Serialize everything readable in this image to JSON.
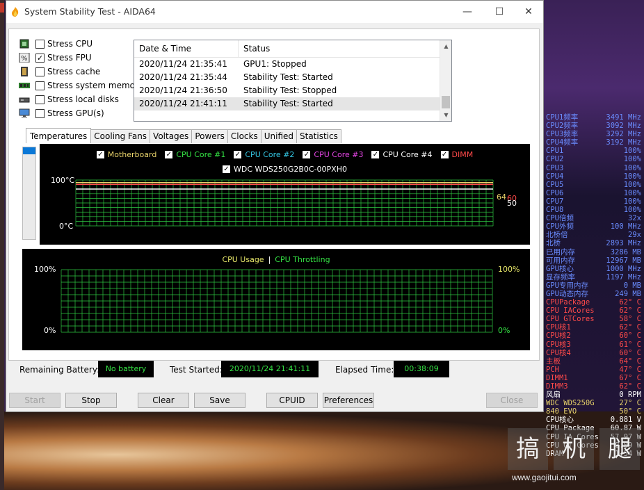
{
  "window": {
    "title": "System Stability Test - AIDA64"
  },
  "titlebar": {
    "min": "—",
    "max": "☐",
    "close": "✕"
  },
  "stress": [
    {
      "label": "Stress CPU",
      "checked": false,
      "icon": "cpu-chip-icon"
    },
    {
      "label": "Stress FPU",
      "checked": true,
      "icon": "percent-icon"
    },
    {
      "label": "Stress cache",
      "checked": false,
      "icon": "cache-chip-icon"
    },
    {
      "label": "Stress system memory",
      "checked": false,
      "icon": "memory-module-icon"
    },
    {
      "label": "Stress local disks",
      "checked": false,
      "icon": "disk-drive-icon"
    },
    {
      "label": "Stress GPU(s)",
      "checked": false,
      "icon": "monitor-icon"
    }
  ],
  "log": {
    "headers": [
      "Date & Time",
      "Status"
    ],
    "rows": [
      [
        "2020/11/24 21:35:41",
        "GPU1: Stopped"
      ],
      [
        "2020/11/24 21:35:44",
        "Stability Test: Started"
      ],
      [
        "2020/11/24 21:36:50",
        "Stability Test: Stopped"
      ],
      [
        "2020/11/24 21:41:11",
        "Stability Test: Started"
      ]
    ],
    "selected_row": 3
  },
  "tabs": [
    "Temperatures",
    "Cooling Fans",
    "Voltages",
    "Powers",
    "Clocks",
    "Unified",
    "Statistics"
  ],
  "active_tab": 0,
  "temp_chart": {
    "legend_row1": [
      {
        "label": "Motherboard",
        "color": "#e8d26a"
      },
      {
        "label": "CPU Core #1",
        "color": "#35e545"
      },
      {
        "label": "CPU Core #2",
        "color": "#35c8e5"
      },
      {
        "label": "CPU Core #3",
        "color": "#e545e5"
      },
      {
        "label": "CPU Core #4",
        "color": "#ffffff"
      },
      {
        "label": "DIMM",
        "color": "#ff4a4a"
      }
    ],
    "legend_row2": [
      {
        "label": "WDC WDS250G2B0C-00PXH0",
        "color": "#ffffff"
      }
    ],
    "y_max_label": "100°C",
    "y_min_label": "0°C",
    "value_labels": [
      "64",
      "60",
      "50"
    ],
    "value_label_colors": [
      "#e8d26a",
      "#ff4a4a",
      "#ffffff"
    ],
    "grid_color": "#2ec842"
  },
  "usage_chart": {
    "legend_a": "CPU Usage",
    "legend_sep": "|",
    "legend_b": "CPU Throttling",
    "legend_a_color": "#e8e86a",
    "legend_b_color": "#35e545",
    "y_max_left": "100%",
    "y_min_left": "0%",
    "y_max_right": "100%",
    "y_min_right": "0%"
  },
  "status": {
    "battery_label": "Remaining Battery:",
    "battery_value": "No battery",
    "started_label": "Test Started:",
    "started_value": "2020/11/24 21:41:11",
    "elapsed_label": "Elapsed Time:",
    "elapsed_value": "00:38:09"
  },
  "buttons": {
    "start": "Start",
    "stop": "Stop",
    "clear": "Clear",
    "save": "Save",
    "cpuid": "CPUID",
    "preferences": "Preferences",
    "close": "Close"
  },
  "osd": [
    {
      "k": "CPU1频率",
      "v": "3491 MHz",
      "c": "#6a8cff"
    },
    {
      "k": "CPU2频率",
      "v": "3092 MHz",
      "c": "#6a8cff"
    },
    {
      "k": "CPU3频率",
      "v": "3292 MHz",
      "c": "#6a8cff"
    },
    {
      "k": "CPU4频率",
      "v": "3192 MHz",
      "c": "#6a8cff"
    },
    {
      "k": "CPU1",
      "v": "100%",
      "c": "#6a8cff"
    },
    {
      "k": "CPU2",
      "v": "100%",
      "c": "#6a8cff"
    },
    {
      "k": "CPU3",
      "v": "100%",
      "c": "#6a8cff"
    },
    {
      "k": "CPU4",
      "v": "100%",
      "c": "#6a8cff"
    },
    {
      "k": "CPU5",
      "v": "100%",
      "c": "#6a8cff"
    },
    {
      "k": "CPU6",
      "v": "100%",
      "c": "#6a8cff"
    },
    {
      "k": "CPU7",
      "v": "100%",
      "c": "#6a8cff"
    },
    {
      "k": "CPU8",
      "v": "100%",
      "c": "#6a8cff"
    },
    {
      "k": "CPU倍频",
      "v": "32x",
      "c": "#6a8cff"
    },
    {
      "k": "CPU外频",
      "v": "100 MHz",
      "c": "#6a8cff"
    },
    {
      "k": "北桥倍",
      "v": "29x",
      "c": "#6a8cff"
    },
    {
      "k": "北桥",
      "v": "2893 MHz",
      "c": "#6a8cff"
    },
    {
      "k": "已用内存",
      "v": "3286 MB",
      "c": "#6a8cff"
    },
    {
      "k": "可用内存",
      "v": "12967 MB",
      "c": "#6a8cff"
    },
    {
      "k": "GPU核心",
      "v": "1000 MHz",
      "c": "#6a8cff"
    },
    {
      "k": "显存频率",
      "v": "1197 MHz",
      "c": "#6a8cff"
    },
    {
      "k": "GPU专用内存",
      "v": "0 MB",
      "c": "#6a8cff"
    },
    {
      "k": "GPU动态内存",
      "v": "249 MB",
      "c": "#6a8cff"
    },
    {
      "k": "CPUPackage",
      "v": "62° C",
      "c": "#ff4a4a"
    },
    {
      "k": "CPU IACores",
      "v": "62° C",
      "c": "#ff4a4a"
    },
    {
      "k": "CPU GTCores",
      "v": "58° C",
      "c": "#ff4a4a"
    },
    {
      "k": "CPU核1",
      "v": "62° C",
      "c": "#ff4a4a"
    },
    {
      "k": "CPU核2",
      "v": "60° C",
      "c": "#ff4a4a"
    },
    {
      "k": "CPU核3",
      "v": "61° C",
      "c": "#ff4a4a"
    },
    {
      "k": "CPU核4",
      "v": "60° C",
      "c": "#ff4a4a"
    },
    {
      "k": "主板",
      "v": "64° C",
      "c": "#ff4a4a"
    },
    {
      "k": "PCH",
      "v": "47° C",
      "c": "#ff4a4a"
    },
    {
      "k": "DIMM1",
      "v": "67° C",
      "c": "#ff4a4a"
    },
    {
      "k": "DIMM3",
      "v": "62° C",
      "c": "#ff4a4a"
    },
    {
      "k": "风扇",
      "v": "0 RPM",
      "c": "#ffffff"
    },
    {
      "k": "WDC WDS250G",
      "v": "27° C",
      "c": "#e8d26a"
    },
    {
      "k": "840 EVO",
      "v": "50° C",
      "c": "#e8d26a"
    },
    {
      "k": "CPU核心",
      "v": "0.881 V",
      "c": "#ffffff"
    },
    {
      "k": "CPU Package",
      "v": "60.87 W",
      "c": "#ffffff"
    },
    {
      "k": "CPU IA Cores",
      "v": "57.97 W",
      "c": "#ffffff"
    },
    {
      "k": "CPU GT Cores",
      "v": "0.09 W",
      "c": "#ffffff"
    },
    {
      "k": "DRAM",
      "v": "1.54 W",
      "c": "#ffffff"
    }
  ],
  "watermark": {
    "chars": [
      "搞",
      "机",
      "腿"
    ],
    "url": "www.gaojitui.com"
  }
}
